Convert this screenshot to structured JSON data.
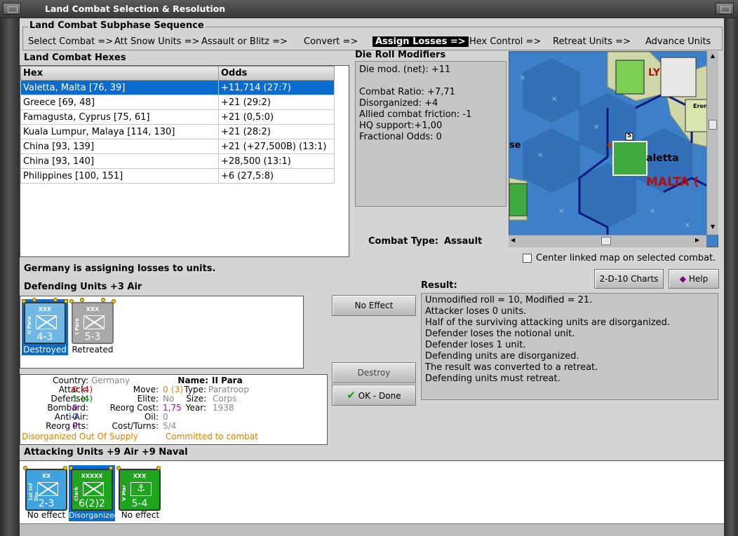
{
  "window": {
    "title": "Land Combat Selection & Resolution"
  },
  "subphase": {
    "title": "Land Combat Subphase Sequence",
    "steps": [
      "Select Combat =>",
      "Att Snow Units =>",
      "Assault or Blitz =>",
      "Convert =>",
      "Assign Losses =>",
      "Hex Control =>",
      "Retreat Units =>",
      "Advance Units"
    ],
    "active_index": 4
  },
  "hexes": {
    "title": "Land Combat Hexes",
    "columns": [
      "Hex",
      "Odds"
    ],
    "rows": [
      [
        "Valetta, Malta [76, 39]",
        "+11,714 (27:7)"
      ],
      [
        "Greece [69, 48]",
        "+21 (29:2)"
      ],
      [
        "Famagusta, Cyprus [75, 61]",
        "+21 (0,5:0)"
      ],
      [
        "Kuala Lumpur, Malaya [114, 130]",
        "+21 (28:2)"
      ],
      [
        "China [93, 139]",
        "+21 (+27,500B) (13:1)"
      ],
      [
        "China [93, 140]",
        "+28,500 (13:1)"
      ],
      [
        "Philippines [100, 151]",
        "+6 (27,5:8)"
      ]
    ],
    "selected_row": 0
  },
  "die_roll": {
    "title": "Die Roll Modifiers",
    "lines": [
      "Die mod. (net): +11",
      "",
      "Combat Ratio: +7,71",
      "Disorganized: +4",
      "Allied combat friction: -1",
      "HQ support:+1,00",
      "Fractional Odds: 0"
    ]
  },
  "combat_type": {
    "label": "Combat Type:",
    "value": "Assault"
  },
  "map": {
    "labels": {
      "valetta": "aletta",
      "malta": "MALTA (",
      "se": "se",
      "italy": "LY",
      "erone": "Erone"
    },
    "unit_stack_count": "5"
  },
  "center_map": {
    "label": "Center linked map on selected combat.",
    "checked": false
  },
  "status": "Germany is assigning losses to units.",
  "buttons": {
    "charts": "2-D-10 Charts",
    "help": "Help",
    "no_effect": "No Effect",
    "destroy": "Destroy",
    "ok": "OK - Done"
  },
  "defending": {
    "title": "Defending Units +3 Air",
    "units": [
      {
        "size": "XXX",
        "name": "II Para",
        "value": "4-3",
        "status": "Destroyed",
        "color": "#6fb8e6"
      },
      {
        "size": "XXX",
        "name": "I Para",
        "value": "5-3",
        "status": "Retreated",
        "color": "#a8a8a8"
      }
    ]
  },
  "details": {
    "country_label": "Country:",
    "country": "Germany",
    "attack_label": "Attack:",
    "attack": "0",
    "attack_base": "(4)",
    "defense_label": "Defense:",
    "defense": "1",
    "defense_base": "(4)",
    "bombard_label": "Bombard:",
    "bombard": "0",
    "antiair_label": "Anti-Air:",
    "antiair": "0",
    "reorgpts_label": "Reorg Pts:",
    "reorgpts": "0",
    "name_label": "Name:",
    "name": "II Para",
    "move_label": "Move:",
    "move": "0",
    "move_base": "(3)",
    "type_label": "Type:",
    "type": "Paratroop",
    "elite_label": "Elite:",
    "elite": "No",
    "size_label": "Size:",
    "size": "Corps",
    "reorgcost_label": "Reorg Cost:",
    "reorgcost": "1,75",
    "year_label": "Year:",
    "year": "1938",
    "oil_label": "Oil:",
    "oil": "0",
    "costturns_label": "Cost/Turns:",
    "costturns": "5/4",
    "flags_a": "Disorganized Out Of Supply",
    "flags_b": "Committed to combat"
  },
  "result": {
    "title": "Result:",
    "lines": [
      "Unmodified roll = 10, Modified = 21.",
      "Attacker loses 0 units.",
      "Half of the surviving attacking units are disorganized.",
      "Defender loses the notional unit.",
      "Defender loses 1 unit.",
      "Defending units are disorganized.",
      "The result was converted to a retreat.",
      "Defending units must retreat."
    ]
  },
  "attacking": {
    "title": "Attacking Units +9 Air +9 Naval",
    "units": [
      {
        "size": "XX",
        "name": "1st Inf Div",
        "value": "2-3",
        "status": "No effect",
        "color": "#3fa3e0"
      },
      {
        "size": "XXXXX",
        "name": "Clark",
        "value": "6(2)2",
        "status": "Disorganized",
        "color": "#1ea41e"
      },
      {
        "size": "XXX",
        "name": "V Mar",
        "value": "5-4",
        "status": "No effect",
        "color": "#1ea41e"
      }
    ]
  }
}
